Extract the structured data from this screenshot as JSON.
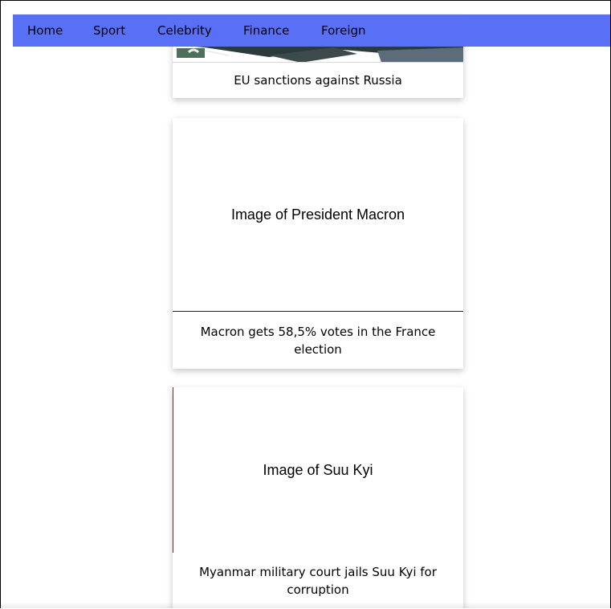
{
  "nav": {
    "items": [
      {
        "label": "Home"
      },
      {
        "label": "Sport"
      },
      {
        "label": "Celebrity"
      },
      {
        "label": "Finance"
      },
      {
        "label": "Foreign"
      }
    ]
  },
  "colors": {
    "navbar": "#5870f5",
    "background": "#ffffff"
  },
  "articles": [
    {
      "image_alt": "",
      "caption": "EU sanctions against Russia"
    },
    {
      "image_alt": "Image of President Macron",
      "caption": "Macron gets 58,5% votes in the France election"
    },
    {
      "image_alt": "Image of Suu Kyi",
      "caption": "Myanmar military court jails Suu Kyi for corruption"
    }
  ]
}
